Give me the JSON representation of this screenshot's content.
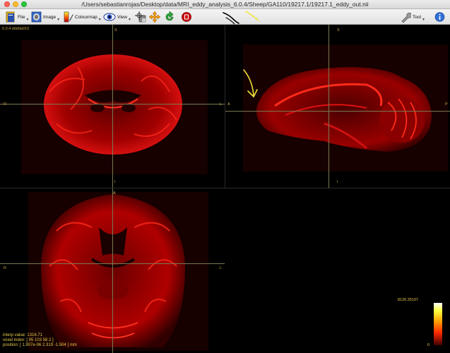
{
  "window": {
    "title": "/Users/sebastianrojas/Desktop/data/MRI_eddy_analysis_6.0.4/Sheep/GA110/19217.1/19217.1_eddy_out.nii"
  },
  "toolbar": {
    "file_label": "File",
    "image_label": "Image",
    "colourmap_label": "Colourmap",
    "view_label": "View",
    "tool_label": "Tool"
  },
  "viewer": {
    "version_text": "6.0.4:dddda010",
    "coronal_labels": {
      "top": "S",
      "bottom": "I",
      "left": "R",
      "right": "L"
    },
    "sagittal_labels": {
      "top": "S",
      "bottom": "I",
      "left": "A",
      "right": "P"
    },
    "axial_labels": {
      "top": "A",
      "left": "R",
      "right": "L"
    },
    "interp_value": "interp value: 1316.71",
    "voxel_index": "voxel index: [ 95 103 58 2 ]",
    "position": "position: [ 1.907e-06 2.319 -1.504 ] mm",
    "colorbar_max": "8120.35107",
    "colorbar_min": "0"
  },
  "colors": {
    "annotation_black": "#000000",
    "annotation_yellow": "#f2e236",
    "accent_red": "#cc1010"
  }
}
